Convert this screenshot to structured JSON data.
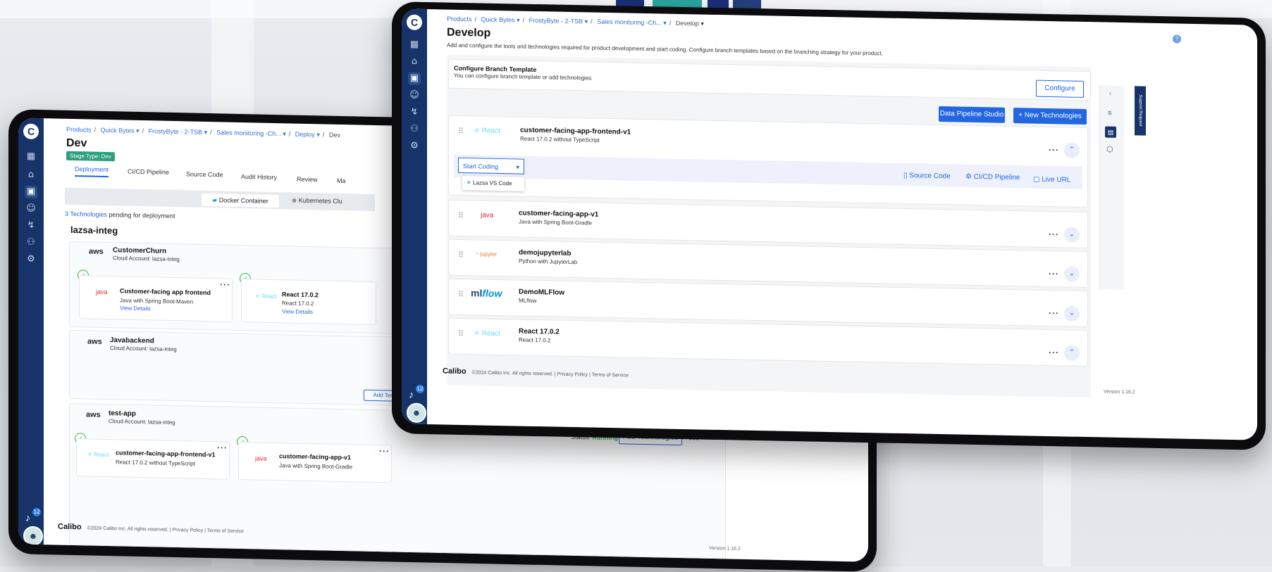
{
  "back": {
    "breadcrumb": [
      "Products",
      "Quick Bytes ▾",
      "FrostyByte - 2-TSB ▾",
      "Sales monitoring -Ch... ▾",
      "Deploy ▾",
      "Dev"
    ],
    "title": "Dev",
    "stage_badge": "Stage Type: Dev",
    "tabs": [
      "Deployment",
      "CI/CD Pipeline",
      "Source Code",
      "Audit History",
      "Review",
      "Ma"
    ],
    "deploy_options": [
      "Docker Container",
      "Kubernetes Clu"
    ],
    "pending_count": "3 Technologies",
    "pending_text": "pending for deployment",
    "env_name": "lazsa-integ",
    "accounts": [
      {
        "name": "CustomerChurn",
        "cloud": "Cloud Account: lazsa-integ"
      },
      {
        "name": "Javabackend",
        "cloud": "Cloud Account: lazsa-integ"
      },
      {
        "name": "test-app",
        "cloud": "Cloud Account: lazsa-integ"
      }
    ],
    "cards": [
      {
        "title": "Customer-facing app frontend",
        "sub": "Java with Spring Boot-Maven",
        "link": "View Details"
      },
      {
        "title": "React 17.0.2",
        "sub": "React 17.0.2",
        "link": "View Details"
      },
      {
        "title": "customer-facing-app-frontend-v1",
        "sub": "React 17.0.2 without TypeScript"
      },
      {
        "title": "customer-facing-app-v1",
        "sub": "Java with Spring Boot-Gradle"
      }
    ],
    "status_label": "Status:",
    "status_value": "Running",
    "add_tech": "Add Technologies",
    "add_tech_hidden": "Add Technologies",
    "footer_brand": "Calibo",
    "footer_text": "©2024 Calibo Inc. All rights reserved.",
    "privacy": "Privacy Policy",
    "terms": "Terms of Service",
    "version": "Version 1.16.2",
    "notif_count": "12"
  },
  "front": {
    "breadcrumb": [
      "Products",
      "Quick Bytes ▾",
      "FrostyByte - 2-TSB ▾",
      "Sales monitoring -Ch... ▾",
      "Develop ▾"
    ],
    "title": "Develop",
    "description": "Add and configure the tools and technologies required for product development and start coding. Configure branch templates based on the branching strategy for your product.",
    "branch_title": "Configure Branch Template",
    "branch_sub": "You can configure branch template or add technologies",
    "configure_btn": "Configure",
    "dps_btn": "Data Pipeline Studio",
    "new_tech_btn": "+ New Technologies",
    "start_coding": "Start Coding",
    "ide_option": "Lazsa VS Code",
    "tool_links": [
      "Source Code",
      "CI/CD Pipeline",
      "Live URL"
    ],
    "technologies": [
      {
        "logo": "React",
        "name": "customer-facing-app-frontend-v1",
        "sub": "React 17.0.2 without TypeScript",
        "expanded": true
      },
      {
        "logo": "Java",
        "name": "customer-facing-app-v1",
        "sub": "Java with Spring Boot-Gradle",
        "expanded": false
      },
      {
        "logo": "jupyter",
        "name": "demojupyterlab",
        "sub": "Python with JupyterLab",
        "expanded": false
      },
      {
        "logo": "mlflow",
        "name": "DemoMLFlow",
        "sub": "MLflow",
        "expanded": false
      },
      {
        "logo": "React",
        "name": "React 17.0.2",
        "sub": "React 17.0.2",
        "expanded": true
      }
    ],
    "support_tab": "Support Request",
    "footer_brand": "Calibo",
    "footer_text": "©2024 Calibo Inc. All rights reserved.",
    "privacy": "Privacy Policy",
    "terms": "Terms of Service",
    "version": "Version 1.16.2",
    "notif_count": "12"
  },
  "colors": {
    "rail": "#17346a",
    "accent": "#2266e0",
    "running": "#3bb54a"
  }
}
